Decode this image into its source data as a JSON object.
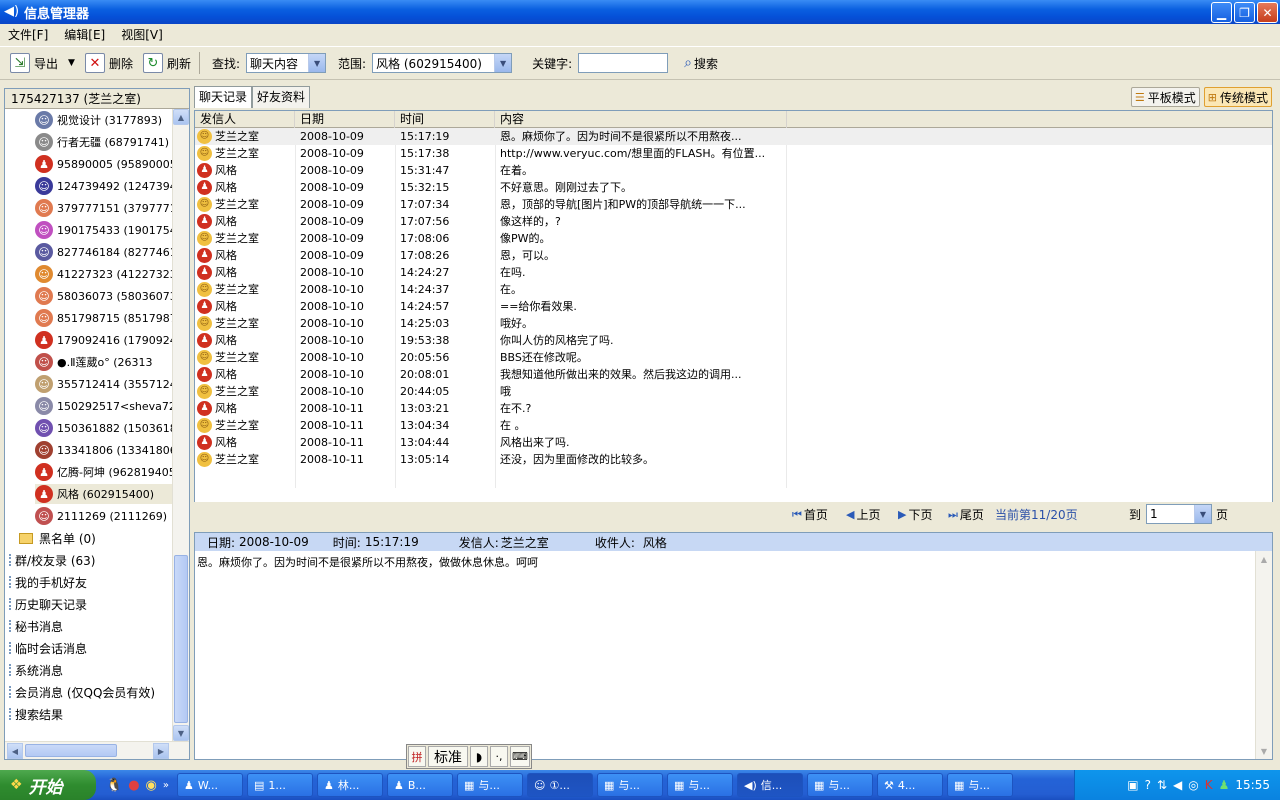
{
  "window": {
    "title": "信息管理器"
  },
  "menu": [
    "文件[F]",
    "编辑[E]",
    "视图[V]"
  ],
  "toolbar": {
    "export_label": "导出",
    "delete_label": "删除",
    "refresh_label": "刷新",
    "find_label": "查找:",
    "find_value": "聊天内容",
    "scope_label": "范围:",
    "scope_value": "风格 (602915400)",
    "keyword_label": "关键字:",
    "keyword_value": "",
    "search_label": "搜索"
  },
  "left": {
    "header": "175427137 (芝兰之室)",
    "contacts": [
      {
        "label": "视觉设计 (3177893)",
        "icon": "avatar-icon",
        "color": "#6a7aa8"
      },
      {
        "label": "行者无疆 (68791741)",
        "icon": "avatar-icon",
        "color": "#8a8a8a"
      },
      {
        "label": "95890005 (95890005)",
        "icon": "penguin-icon",
        "color": "#d03020"
      },
      {
        "label": "124739492 (124739492",
        "icon": "avatar-icon",
        "color": "#3a3a9a"
      },
      {
        "label": "379777151 (379777151",
        "icon": "avatar-icon",
        "color": "#e07a50"
      },
      {
        "label": "190175433 (19017543",
        "icon": "avatar-icon",
        "color": "#c050c0"
      },
      {
        "label": "827746184 (827746184",
        "icon": "avatar-icon",
        "color": "#5a5aa0"
      },
      {
        "label": "41227323 (41227323)",
        "icon": "avatar-icon",
        "color": "#e08a30"
      },
      {
        "label": "58036073 (58036073)",
        "icon": "avatar-icon",
        "color": "#e07a50"
      },
      {
        "label": "851798715 (851798715",
        "icon": "avatar-icon",
        "color": "#e07a50"
      },
      {
        "label": "179092416 (17909241",
        "icon": "penguin-icon",
        "color": "#d03020"
      },
      {
        "label": "●.Ⅱ莲葳o° (26313",
        "icon": "avatar-icon",
        "color": "#c0504a"
      },
      {
        "label": "355712414 (35571241",
        "icon": "avatar-icon",
        "color": "#c0a070"
      },
      {
        "label": "150292517<sheva7251",
        "icon": "avatar-icon",
        "color": "#8a8aa8"
      },
      {
        "label": "150361882 (15036188",
        "icon": "avatar-icon",
        "color": "#7050b0"
      },
      {
        "label": "13341806 (13341806)",
        "icon": "avatar-icon",
        "color": "#a04030"
      },
      {
        "label": "亿腾-阿坤 (962819405",
        "icon": "penguin-icon",
        "color": "#d03020"
      },
      {
        "label": "风格 (602915400)",
        "icon": "penguin-icon",
        "color": "#d03020",
        "selected": true
      },
      {
        "label": "2111269 (2111269)",
        "icon": "avatar-icon",
        "color": "#c05050"
      }
    ],
    "blacklist": "黑名单 (0)",
    "categories": [
      "群/校友录 (63)",
      "我的手机好友",
      "历史聊天记录",
      "秘书消息",
      "临时会话消息",
      "系统消息",
      "会员消息 (仅QQ会员有效)",
      "搜索结果"
    ]
  },
  "tabs": [
    "聊天记录",
    "好友资料"
  ],
  "modes": [
    "平板模式",
    "传统模式"
  ],
  "grid": {
    "headers": [
      "发信人",
      "日期",
      "时间",
      "内容"
    ],
    "rows": [
      {
        "sender": "芝兰之室",
        "date": "2008-10-09",
        "time": "15:17:19",
        "content": "恩。麻烦你了。因为时间不是很紧所以不用熬夜...",
        "self": true
      },
      {
        "sender": "芝兰之室",
        "date": "2008-10-09",
        "time": "15:17:38",
        "content": "http://www.veryuc.com/想里面的FLASH。有位置...",
        "self": true
      },
      {
        "sender": "风格",
        "date": "2008-10-09",
        "time": "15:31:47",
        "content": "在着。",
        "self": false
      },
      {
        "sender": "风格",
        "date": "2008-10-09",
        "time": "15:32:15",
        "content": " 不好意思。刚刚过去了下。",
        "self": false
      },
      {
        "sender": "芝兰之室",
        "date": "2008-10-09",
        "time": "17:07:34",
        "content": "恩，顶部的导航[图片]和PW的顶部导航统一一下...",
        "self": true
      },
      {
        "sender": "风格",
        "date": "2008-10-09",
        "time": "17:07:56",
        "content": "像这样的，?",
        "self": false
      },
      {
        "sender": "芝兰之室",
        "date": "2008-10-09",
        "time": "17:08:06",
        "content": "像PW的。",
        "self": true
      },
      {
        "sender": "风格",
        "date": "2008-10-09",
        "time": "17:08:26",
        "content": "恩，可以。",
        "self": false
      },
      {
        "sender": "风格",
        "date": "2008-10-10",
        "time": "14:24:27",
        "content": "在吗.",
        "self": false
      },
      {
        "sender": "芝兰之室",
        "date": "2008-10-10",
        "time": "14:24:37",
        "content": "在。",
        "self": true
      },
      {
        "sender": "风格",
        "date": "2008-10-10",
        "time": "14:24:57",
        "content": "==给你看效果.",
        "self": false
      },
      {
        "sender": "芝兰之室",
        "date": "2008-10-10",
        "time": "14:25:03",
        "content": "哦好。",
        "self": true
      },
      {
        "sender": "风格",
        "date": "2008-10-10",
        "time": "19:53:38",
        "content": " 你叫人仿的风格完了吗.",
        "self": false
      },
      {
        "sender": "芝兰之室",
        "date": "2008-10-10",
        "time": "20:05:56",
        "content": "BBS还在修改呢。",
        "self": true
      },
      {
        "sender": "风格",
        "date": "2008-10-10",
        "time": "20:08:01",
        "content": " 我想知道他所做出来的效果。然后我这边的调用...",
        "self": false
      },
      {
        "sender": "芝兰之室",
        "date": "2008-10-10",
        "time": "20:44:05",
        "content": "哦",
        "self": true
      },
      {
        "sender": "风格",
        "date": "2008-10-11",
        "time": "13:03:21",
        "content": "在不.?",
        "self": false
      },
      {
        "sender": "芝兰之室",
        "date": "2008-10-11",
        "time": "13:04:34",
        "content": "在 。",
        "self": true
      },
      {
        "sender": "风格",
        "date": "2008-10-11",
        "time": "13:04:44",
        "content": " 风格出来了吗.",
        "self": false
      },
      {
        "sender": "芝兰之室",
        "date": "2008-10-11",
        "time": "13:05:14",
        "content": "还没，因为里面修改的比较多。",
        "self": true
      }
    ]
  },
  "pager": {
    "first": "首页",
    "prev": "上页",
    "next": "下页",
    "last": "尾页",
    "status": "当前第11/20页",
    "goto_label": "到",
    "goto_value": "1",
    "page_unit": "页"
  },
  "detail": {
    "date_label": "日期:",
    "date": "2008-10-09",
    "time_label": "时间:",
    "time": "15:17:19",
    "sender_label": "发信人:",
    "sender": "芝兰之室",
    "receiver_label": "收件人:",
    "receiver": "风格",
    "body": "恩。麻烦你了。因为时间不是很紧所以不用熬夜，做做休息休息。呵呵"
  },
  "ime": {
    "mode": "标准"
  },
  "taskbar": {
    "start": "开始",
    "tasks": [
      {
        "label": "W...",
        "icon": "qq-icon"
      },
      {
        "label": "1...",
        "icon": "folder-icon"
      },
      {
        "label": "林...",
        "icon": "qq-icon"
      },
      {
        "label": "B...",
        "icon": "qq-icon"
      },
      {
        "label": "与...",
        "icon": "chat-icon"
      },
      {
        "label": "①...",
        "icon": "avatar-icon",
        "active": true
      },
      {
        "label": "与...",
        "icon": "chat-icon"
      },
      {
        "label": "与...",
        "icon": "chat-icon"
      },
      {
        "label": "信...",
        "icon": "speaker-icon",
        "active": true
      },
      {
        "label": "与...",
        "icon": "chat-icon"
      },
      {
        "label": "4...",
        "icon": "tool-icon"
      },
      {
        "label": "与...",
        "icon": "chat-icon"
      }
    ],
    "clock": "15:55"
  }
}
